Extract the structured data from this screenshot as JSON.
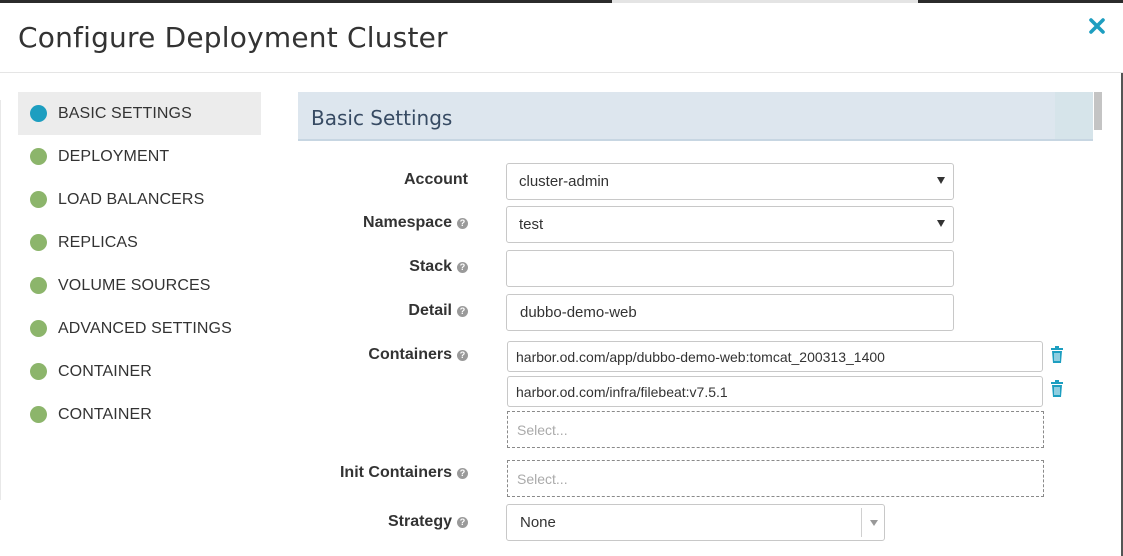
{
  "modal": {
    "title": "Configure Deployment Cluster",
    "close_icon": "close-icon",
    "accent_color": "#1d9ec0"
  },
  "sidebar": {
    "items": [
      {
        "label": "BASIC SETTINGS",
        "active": true,
        "dot_color": "#1d9ec0"
      },
      {
        "label": "DEPLOYMENT",
        "active": false,
        "dot_color": "#8cb56b"
      },
      {
        "label": "LOAD BALANCERS",
        "active": false,
        "dot_color": "#8cb56b"
      },
      {
        "label": "REPLICAS",
        "active": false,
        "dot_color": "#8cb56b"
      },
      {
        "label": "VOLUME SOURCES",
        "active": false,
        "dot_color": "#8cb56b"
      },
      {
        "label": "ADVANCED SETTINGS",
        "active": false,
        "dot_color": "#8cb56b"
      },
      {
        "label": "CONTAINER",
        "active": false,
        "dot_color": "#8cb56b"
      },
      {
        "label": "CONTAINER",
        "active": false,
        "dot_color": "#8cb56b"
      }
    ]
  },
  "section": {
    "title": "Basic Settings"
  },
  "form": {
    "account": {
      "label": "Account",
      "value": "cluster-admin"
    },
    "namespace": {
      "label": "Namespace",
      "value": "test"
    },
    "stack": {
      "label": "Stack",
      "value": ""
    },
    "detail": {
      "label": "Detail",
      "value": "dubbo-demo-web"
    },
    "containers": {
      "label": "Containers",
      "items": [
        "harbor.od.com/app/dubbo-demo-web:tomcat_200313_1400",
        "harbor.od.com/infra/filebeat:v7.5.1"
      ],
      "placeholder": "Select..."
    },
    "init_containers": {
      "label": "Init Containers",
      "placeholder": "Select..."
    },
    "strategy": {
      "label": "Strategy",
      "value": "None"
    },
    "help_glyph": "?"
  }
}
